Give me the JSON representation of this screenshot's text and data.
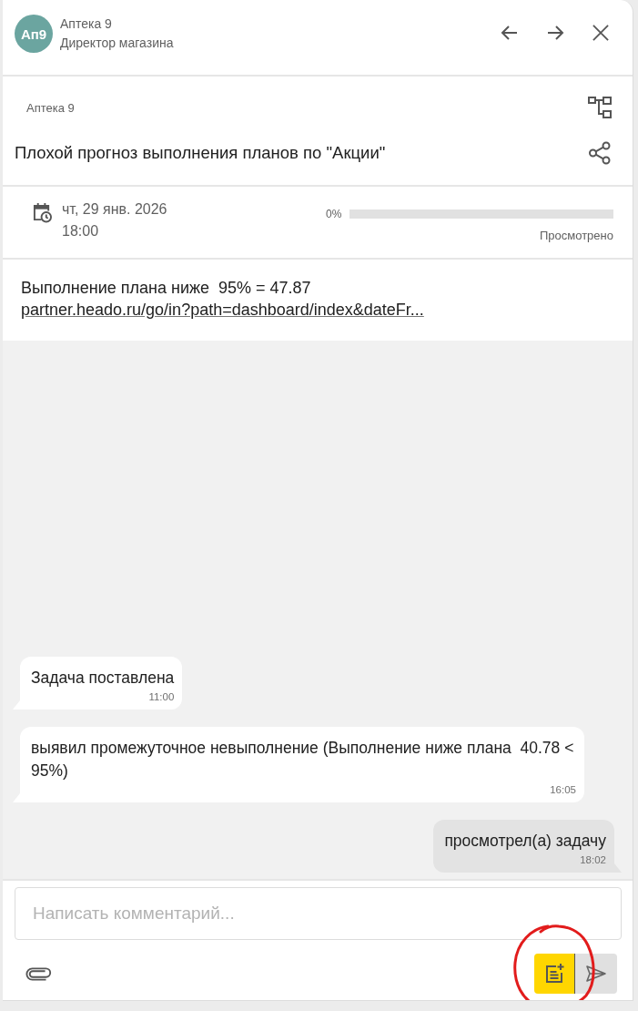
{
  "header": {
    "avatar": "Ап9",
    "name": "Аптека 9",
    "role": "Директор магазина"
  },
  "task": {
    "store": "Аптека 9",
    "title": "Плохой прогноз выполнения планов по \"Акции\"",
    "date": "чт, 29 янв. 2026",
    "time": "18:00",
    "progress": {
      "reading": "0%",
      "level": 0,
      "label": "Просмотрено"
    },
    "description": {
      "text": "Выполнение плана ниже  95% = 47.87",
      "link": "partner.heado.ru/go/in?path=dashboard/index&dateFr..."
    }
  },
  "messages": [
    {
      "text": "Задача поставлена",
      "time": "11:00",
      "own": false
    },
    {
      "text": "выявил промежуточное невыполнение (Выполнение ниже плана  40.78 < 95%)",
      "time": "16:05",
      "own": false
    },
    {
      "text": "просмотрел(а) задачу",
      "time": "18:02",
      "own": true
    }
  ],
  "composer": {
    "placeholder": "Написать комментарий..."
  }
}
